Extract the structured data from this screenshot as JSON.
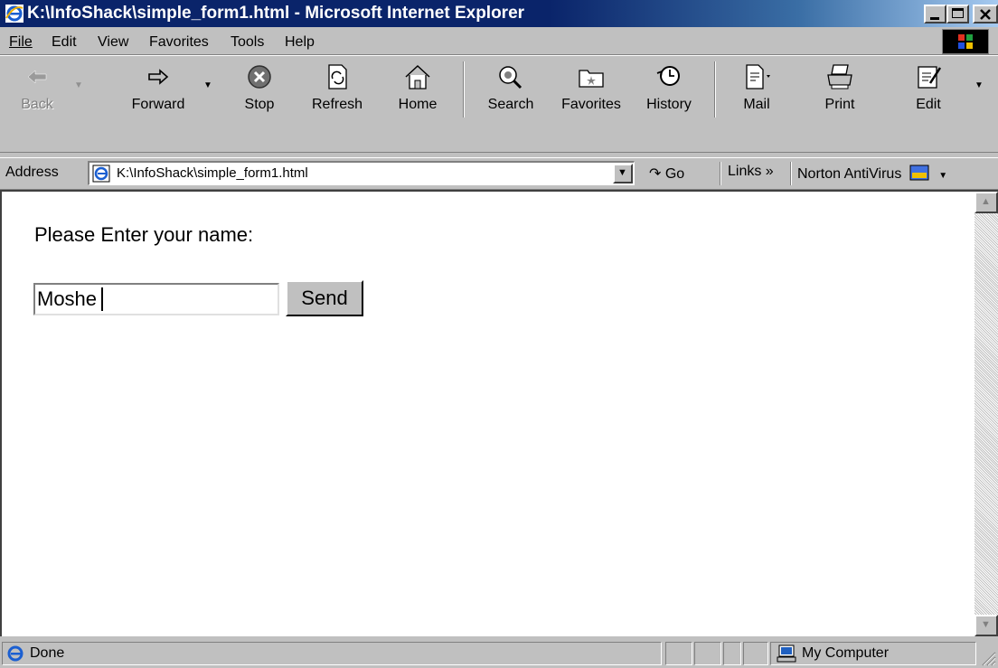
{
  "window": {
    "title": "K:\\InfoShack\\simple_form1.html - Microsoft Internet Explorer"
  },
  "menu": {
    "file": "File",
    "edit": "Edit",
    "view": "View",
    "favorites": "Favorites",
    "tools": "Tools",
    "help": "Help"
  },
  "toolbar": {
    "back": "Back",
    "forward": "Forward",
    "stop": "Stop",
    "refresh": "Refresh",
    "home": "Home",
    "search": "Search",
    "favorites": "Favorites",
    "history": "History",
    "mail": "Mail",
    "print": "Print",
    "edit": "Edit"
  },
  "address": {
    "label": "Address",
    "url": "K:\\InfoShack\\simple_form1.html",
    "go": "Go",
    "links": "Links »",
    "norton": "Norton AntiVirus"
  },
  "page": {
    "prompt": "Please Enter your name:",
    "name_value": "Moshe",
    "send_label": "Send"
  },
  "status": {
    "text": "Done",
    "zone": "My Computer"
  }
}
